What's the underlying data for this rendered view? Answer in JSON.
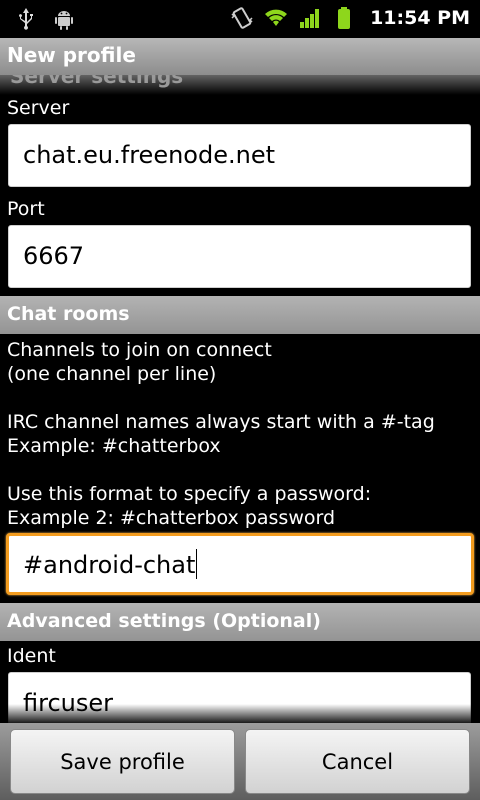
{
  "status_bar": {
    "time": "11:54 PM",
    "icons": [
      "usb-icon",
      "android-debug-icon",
      "vibrate-icon",
      "wifi-icon",
      "signal-icon",
      "battery-icon"
    ]
  },
  "header": {
    "title": "New profile",
    "prev_section_title": "Server settings"
  },
  "server_settings": {
    "server_label": "Server",
    "server_value": "chat.eu.freenode.net",
    "port_label": "Port",
    "port_value": "6667"
  },
  "chat_rooms": {
    "section_title": "Chat rooms",
    "help_line1": "Channels to join on connect",
    "help_line2": "(one channel per line)",
    "help_line3": "IRC channel names always start with a #-tag",
    "help_line4": "Example: #chatterbox",
    "help_line5": "Use this format to specify a password:",
    "help_line6": "Example 2: #chatterbox password",
    "channels_value": "#android-chat"
  },
  "advanced": {
    "section_title": "Advanced settings (Optional)",
    "ident_label": "Ident",
    "ident_value": "fircuser"
  },
  "actions": {
    "save_label": "Save profile",
    "cancel_label": "Cancel"
  },
  "colors": {
    "focus_border": "#f39c1f",
    "section_header": "#a4a4a4",
    "battery_green": "#8ed61c"
  }
}
